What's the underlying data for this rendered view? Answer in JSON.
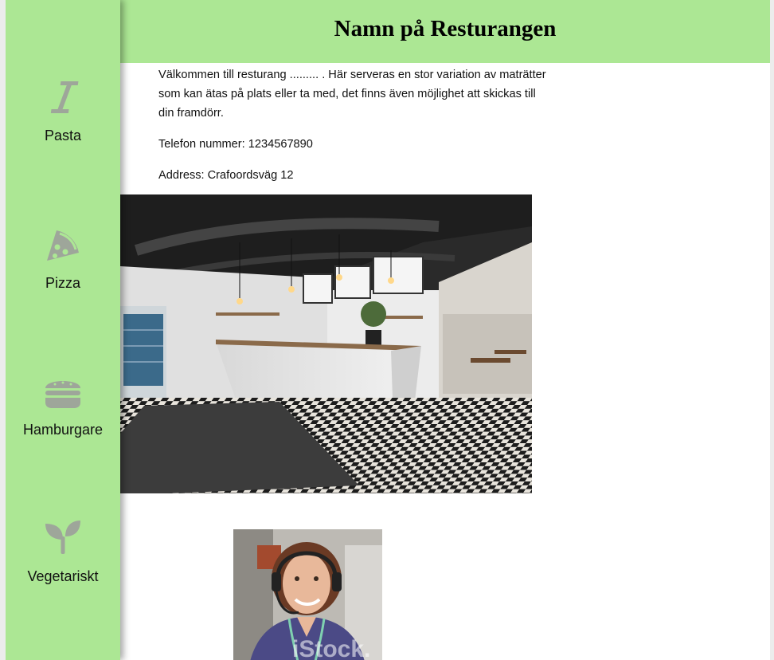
{
  "header": {
    "title": "Namn på Resturangen"
  },
  "sidebar": {
    "items": [
      {
        "label": "Pasta",
        "icon": "italic-i-icon"
      },
      {
        "label": "Pizza",
        "icon": "pizza-slice-icon"
      },
      {
        "label": "Hamburgare",
        "icon": "burger-icon"
      },
      {
        "label": "Vegetariskt",
        "icon": "seedling-icon"
      }
    ]
  },
  "main": {
    "intro_line1": "Välkommen till resturang ......... . Här serveras en stor variation av maträtter",
    "intro_line2": "som kan ätas på plats eller ta med, det finns även möjlighet att skickas till",
    "intro_line3": "din framdörr.",
    "phone": "Telefon nummer: 1234567890",
    "address": "Address: Crafoordsväg 12"
  },
  "images": {
    "staff_watermark": "iStock."
  },
  "colors": {
    "accent_green": "#ace794",
    "icon_gray": "#9ea69a"
  }
}
